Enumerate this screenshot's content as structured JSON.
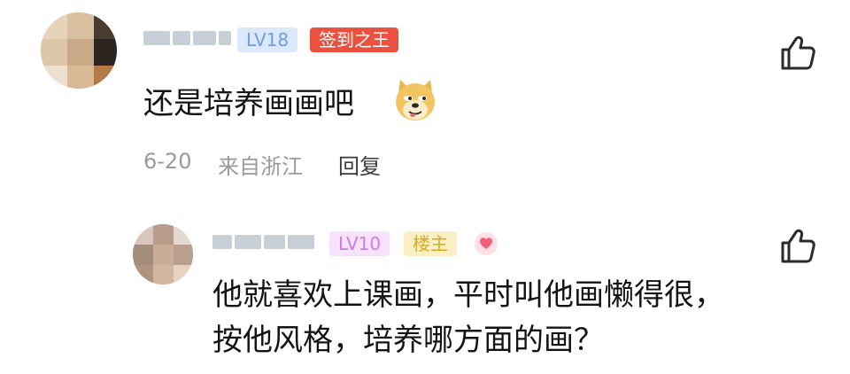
{
  "comment": {
    "level_badge": "LV18",
    "title_badge": "签到之王",
    "text": "还是培养画画吧",
    "emoji_icon": "doge-emoji-icon",
    "date": "6-20",
    "location": "来自浙江",
    "reply_label": "回复"
  },
  "reply": {
    "level_badge": "LV10",
    "owner_badge": "楼主",
    "text_line1": "他就喜欢上课画，平时叫他画懒得很，",
    "text_line2": "按他风格，培养哪方面的画？"
  },
  "colors": {
    "lv18_badge": "#6d9ee6",
    "sign_badge": "#ec5140",
    "lv10_badge": "#d17ae6",
    "owner_badge": "#d6a928"
  }
}
